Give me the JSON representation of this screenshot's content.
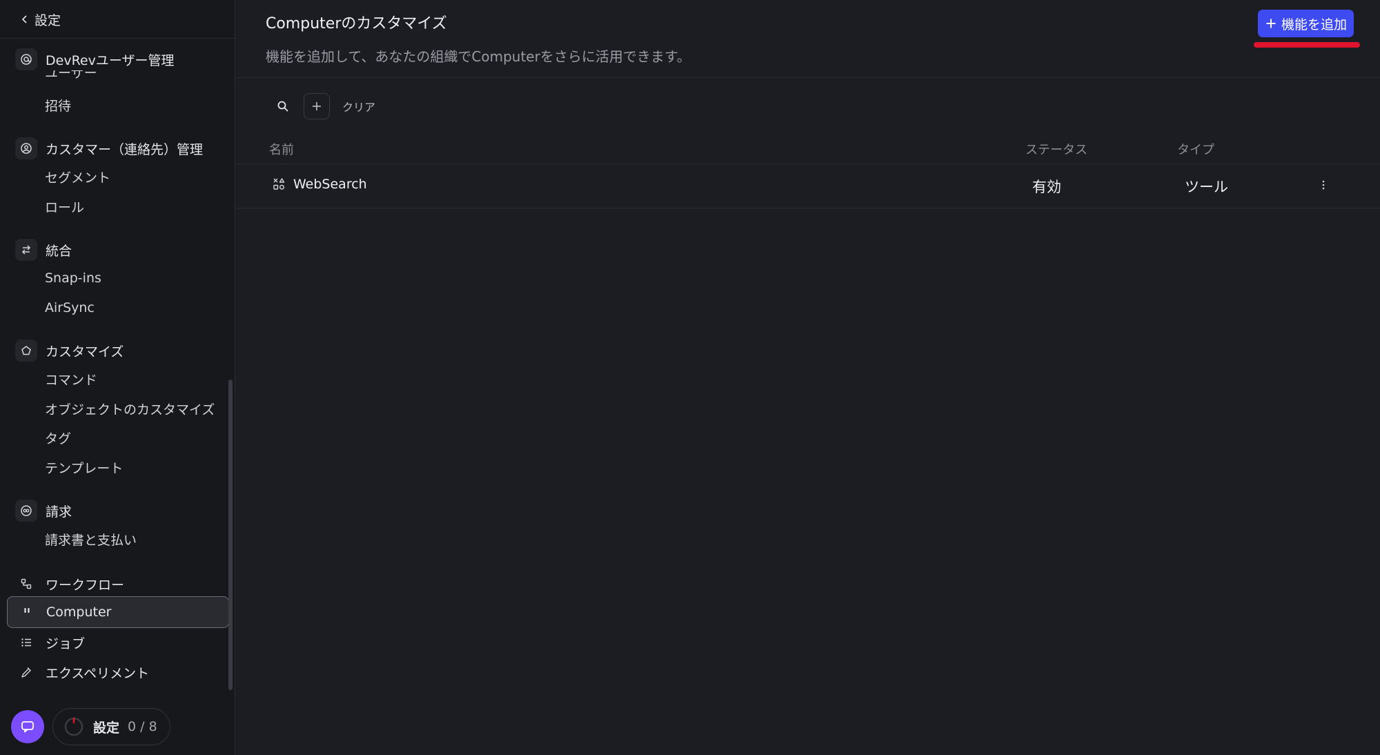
{
  "sidebar": {
    "back_label": "設定",
    "groups": [
      {
        "label": "DevRevユーザー管理",
        "icon": "at-icon",
        "items": [
          "ユーザー",
          "招待"
        ]
      },
      {
        "label": "カスタマー（連絡先）管理",
        "icon": "contact-icon",
        "items": [
          "セグメント",
          "ロール"
        ]
      },
      {
        "label": "統合",
        "icon": "integration-icon",
        "items": [
          "Snap-ins",
          "AirSync"
        ]
      },
      {
        "label": "カスタマイズ",
        "icon": "pentagon-icon",
        "items": [
          "コマンド",
          "オブジェクトのカスタマイズ",
          "タグ",
          "テンプレート"
        ]
      },
      {
        "label": "請求",
        "icon": "billing-icon",
        "items": [
          "請求書と支払い"
        ]
      }
    ],
    "bottom_items": [
      {
        "label": "ワークフロー",
        "icon": "workflow-icon"
      },
      {
        "label": "Computer",
        "icon": "quote-icon",
        "active": true
      },
      {
        "label": "ジョブ",
        "icon": "list-icon"
      },
      {
        "label": "エクスペリメント",
        "icon": "flask-icon"
      }
    ],
    "setup": {
      "label": "設定",
      "count": "0 / 8",
      "progress": 0
    }
  },
  "header": {
    "title": "Computerのカスタマイズ",
    "subtitle": "機能を追加して、あなたの組織でComputerをさらに活用できます。",
    "add_button_label": "機能を追加"
  },
  "filter": {
    "clear_label": "クリア"
  },
  "table": {
    "columns": [
      "名前",
      "ステータス",
      "タイプ"
    ],
    "rows": [
      {
        "name": "WebSearch",
        "status": "有効",
        "type": "ツール"
      }
    ]
  },
  "colors": {
    "accent": "#3d4bf0",
    "highlight": "#e0142c",
    "chat": "#7c4dff",
    "background": "#1c1d22",
    "sidebar": "#17181c"
  }
}
